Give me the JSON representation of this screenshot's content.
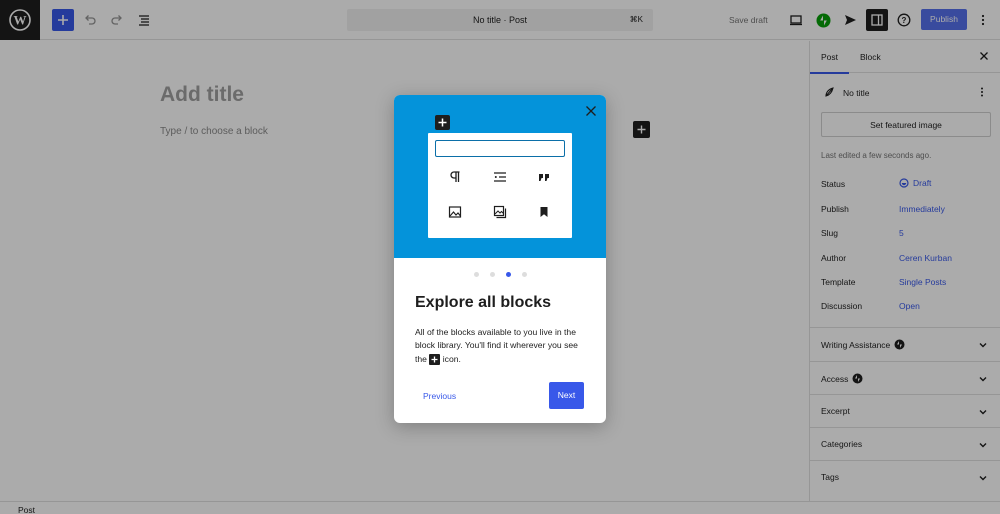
{
  "toolbar": {
    "title": "No title · Post",
    "shortcut": "⌘K",
    "save_draft": "Save draft",
    "publish": "Publish",
    "icons": [
      "wordpress-logo",
      "plus",
      "undo",
      "redo",
      "list-view",
      "desktop-preview",
      "jetpack",
      "send",
      "sidebar-toggle",
      "help",
      "more-vertical"
    ]
  },
  "editor": {
    "title_placeholder": "Add title",
    "block_placeholder": "Type / to choose a block"
  },
  "sidebar": {
    "tabs": [
      "Post",
      "Block"
    ],
    "summary": {
      "title": "No title",
      "featured_button": "Set featured image",
      "last_edited": "Last edited a few seconds ago."
    },
    "rows": [
      {
        "label": "Status",
        "value": "Draft"
      },
      {
        "label": "Publish",
        "value": "Immediately"
      },
      {
        "label": "Slug",
        "value": "5"
      },
      {
        "label": "Author",
        "value": "Ceren Kurban"
      },
      {
        "label": "Template",
        "value": "Single Posts"
      },
      {
        "label": "Discussion",
        "value": "Open"
      }
    ],
    "panels": [
      {
        "label": "Writing Assistance"
      },
      {
        "label": "Access"
      },
      {
        "label": "Excerpt"
      },
      {
        "label": "Categories"
      },
      {
        "label": "Tags"
      }
    ]
  },
  "statusbar": {
    "label": "Post"
  },
  "modal": {
    "title": "Explore all blocks",
    "text_before": "All of the blocks available to you live in the block library. You'll find it wherever you see the",
    "text_after": "icon.",
    "previous": "Previous",
    "next": "Next",
    "page_count": 4,
    "current_page": 3
  },
  "colors": {
    "accent": "#3858e9",
    "hero": "#0493da"
  }
}
